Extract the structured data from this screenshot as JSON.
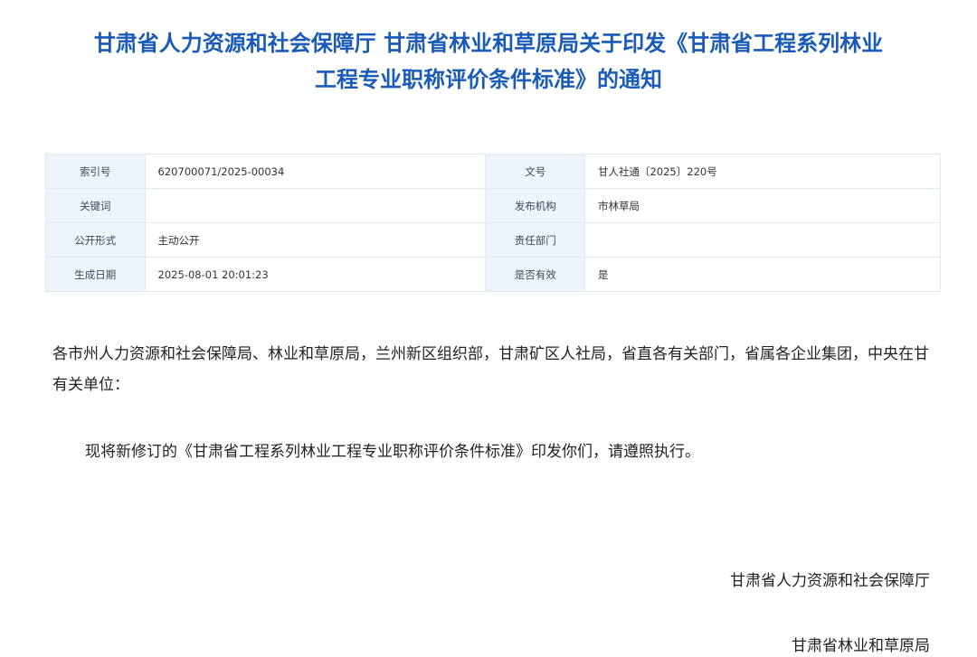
{
  "document": {
    "title_line1": "甘肃省人力资源和社会保障厅 甘肃省林业和草原局关于印发《甘肃省工程系列林业",
    "title_line2": "工程专业职称评价条件标准》的通知"
  },
  "metadata": {
    "rows": [
      {
        "label_left": "索引号",
        "value_left": "620700071/2025-00034",
        "label_right": "文号",
        "value_right": "甘人社通〔2025〕220号"
      },
      {
        "label_left": "关键词",
        "value_left": "",
        "label_right": "发布机构",
        "value_right": "市林草局"
      },
      {
        "label_left": "公开形式",
        "value_left": "主动公开",
        "label_right": "责任部门",
        "value_right": ""
      },
      {
        "label_left": "生成日期",
        "value_left": "2025-08-01 20:01:23",
        "label_right": "是否有效",
        "value_right": "是"
      }
    ]
  },
  "body": {
    "salutation": "各市州人力资源和社会保障局、林业和草原局，兰州新区组织部，甘肃矿区人社局，省直各有关部门，省属各企业集团，中央在甘有关单位：",
    "paragraph": "现将新修订的《甘肃省工程系列林业工程专业职称评价条件标准》印发你们，请遵照执行。",
    "signature_1": "甘肃省人力资源和社会保障厅",
    "signature_2": "甘肃省林业和草原局"
  },
  "colors": {
    "title": "#1a5bb8",
    "label_background": "#eef4fb",
    "border": "#e3e9f1"
  }
}
